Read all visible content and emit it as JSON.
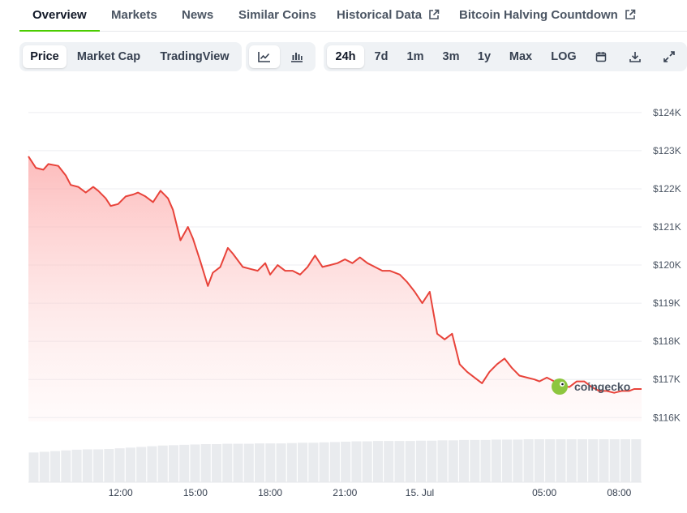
{
  "tabs": [
    {
      "label": "Overview",
      "active": true
    },
    {
      "label": "Markets"
    },
    {
      "label": "News"
    },
    {
      "label": "Similar Coins"
    },
    {
      "label": "Historical Data",
      "external": true
    },
    {
      "label": "Bitcoin Halving Countdown",
      "external": true
    }
  ],
  "toolbar": {
    "views": [
      "Price",
      "Market Cap",
      "TradingView"
    ],
    "selected_view": "Price",
    "chart_styles": [
      "line-chart-icon",
      "candlestick-icon"
    ],
    "ranges": [
      "24h",
      "7d",
      "1m",
      "3m",
      "1y",
      "Max",
      "LOG"
    ],
    "selected_range": "24h",
    "actions": [
      "calendar-icon",
      "download-icon",
      "expand-icon"
    ]
  },
  "watermark": "coingecko",
  "colors": {
    "line": "#e8433a",
    "fill": "#fecaca",
    "accent": "#4bcc00",
    "volume": "#e5e7eb"
  },
  "chart_data": {
    "type": "area",
    "title": "",
    "xlabel": "",
    "ylabel": "",
    "y_ticks": [
      "$124K",
      "$123K",
      "$122K",
      "$121K",
      "$120K",
      "$119K",
      "$118K",
      "$117K",
      "$116K"
    ],
    "ylim": [
      115900,
      124400
    ],
    "x_ticks": [
      "12:00",
      "15:00",
      "18:00",
      "21:00",
      "15. Jul",
      "05:00",
      "08:00"
    ],
    "x_tick_hours": [
      12,
      15,
      18,
      21,
      24,
      29,
      32
    ],
    "x_range_hours": [
      8.3,
      32.9
    ],
    "grid": true,
    "series": [
      {
        "x": [
          8.3,
          8.6,
          8.9,
          9.1,
          9.5,
          9.8,
          10.0,
          10.3,
          10.6,
          10.9,
          11.1,
          11.4,
          11.6,
          11.9,
          12.2,
          12.5,
          12.7,
          13.0,
          13.3,
          13.6,
          13.9,
          14.1,
          14.4,
          14.7,
          14.9,
          15.2,
          15.5,
          15.7,
          16.0,
          16.3,
          16.5,
          16.9,
          17.2,
          17.5,
          17.8,
          18.0,
          18.3,
          18.6,
          18.9,
          19.2,
          19.5,
          19.8,
          20.1,
          20.4,
          20.7,
          21.0,
          21.3,
          21.6,
          21.9,
          22.2,
          22.5,
          22.8,
          23.2,
          23.5,
          23.8,
          24.1,
          24.4,
          24.7,
          25.0,
          25.3,
          25.6,
          25.9,
          26.2,
          26.5,
          26.8,
          27.1,
          27.4,
          27.7,
          28.0,
          28.3,
          28.6,
          28.8,
          29.1,
          29.4,
          29.7,
          30.0,
          30.3,
          30.6,
          30.9,
          31.2,
          31.5,
          31.8,
          32.1,
          32.4,
          32.6,
          32.9
        ],
        "values": [
          122.85,
          122.55,
          122.5,
          122.65,
          122.6,
          122.35,
          122.1,
          122.05,
          121.9,
          122.05,
          121.95,
          121.75,
          121.55,
          121.6,
          121.8,
          121.85,
          121.9,
          121.8,
          121.65,
          121.95,
          121.75,
          121.45,
          120.65,
          121.0,
          120.7,
          120.1,
          119.45,
          119.8,
          119.95,
          120.45,
          120.3,
          119.95,
          119.9,
          119.85,
          120.05,
          119.75,
          120.0,
          119.85,
          119.85,
          119.75,
          119.95,
          120.25,
          119.95,
          120.0,
          120.05,
          120.15,
          120.05,
          120.2,
          120.05,
          119.95,
          119.85,
          119.85,
          119.75,
          119.55,
          119.3,
          119.0,
          119.3,
          118.2,
          118.05,
          118.2,
          117.4,
          117.2,
          117.05,
          116.9,
          117.2,
          117.4,
          117.55,
          117.3,
          117.1,
          117.05,
          117.0,
          116.95,
          117.05,
          116.95,
          116.85,
          116.8,
          116.95,
          116.95,
          116.8,
          116.7,
          116.7,
          116.65,
          116.7,
          116.7,
          116.75,
          116.75
        ]
      },
      {
        "name": "",
        "type": "volume",
        "values_relative": [
          0.62,
          0.64,
          0.66,
          0.68,
          0.7,
          0.71,
          0.71,
          0.72,
          0.74,
          0.76,
          0.78,
          0.8,
          0.82,
          0.83,
          0.84,
          0.85,
          0.86,
          0.86,
          0.87,
          0.87,
          0.87,
          0.88,
          0.88,
          0.88,
          0.89,
          0.9,
          0.9,
          0.91,
          0.92,
          0.93,
          0.94,
          0.94,
          0.95,
          0.95,
          0.95,
          0.95,
          0.96,
          0.96,
          0.97,
          0.97,
          0.98,
          0.98,
          0.98,
          0.99,
          0.99,
          0.99,
          1.0,
          1.0,
          1.0,
          1.0,
          1.0,
          1.0,
          1.0,
          1.0,
          1.0,
          1.0,
          1.0
        ]
      }
    ]
  }
}
